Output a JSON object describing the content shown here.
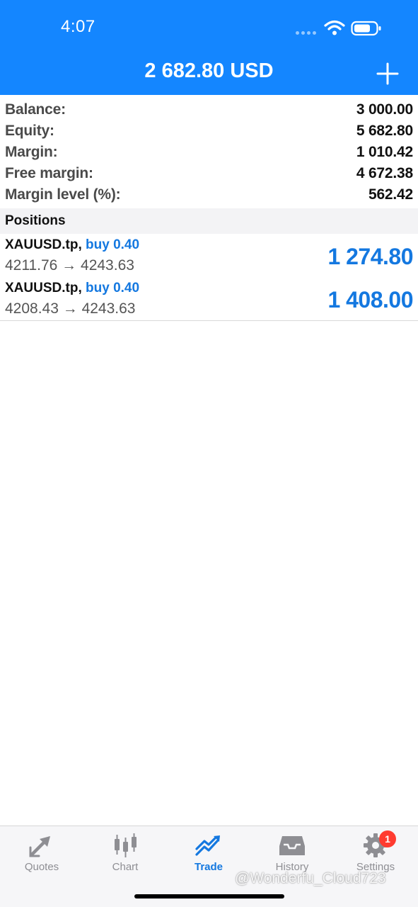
{
  "status_bar": {
    "time": "4:07"
  },
  "header": {
    "title": "2 682.80 USD",
    "add_icon": "plus-icon"
  },
  "summary": [
    {
      "label": "Balance:",
      "value": "3 000.00"
    },
    {
      "label": "Equity:",
      "value": "5 682.80"
    },
    {
      "label": "Margin:",
      "value": "1 010.42"
    },
    {
      "label": "Free margin:",
      "value": "4 672.38"
    },
    {
      "label": "Margin level (%):",
      "value": "562.42"
    }
  ],
  "positions_section": {
    "title": "Positions"
  },
  "positions": [
    {
      "symbol": "XAUUSD.tp,",
      "side": "buy 0.40",
      "prices": "4211.76 → 4243.63",
      "profit": "1 274.80"
    },
    {
      "symbol": "XAUUSD.tp,",
      "side": "buy 0.40",
      "prices": "4208.43 → 4243.63",
      "profit": "1 408.00"
    }
  ],
  "tabbar": {
    "tabs": [
      {
        "label": "Quotes",
        "icon": "quotes-arrows-icon"
      },
      {
        "label": "Chart",
        "icon": "candlestick-icon"
      },
      {
        "label": "Trade",
        "icon": "trade-trend-icon"
      },
      {
        "label": "History",
        "icon": "inbox-tray-icon"
      },
      {
        "label": "Settings",
        "icon": "gear-icon",
        "badge": "1"
      }
    ],
    "active": "Trade"
  },
  "watermark": "@Wonderfu_Cloud723",
  "colors": {
    "accent": "#1486ff",
    "profit": "#1478e0",
    "badge": "#ff3b30"
  }
}
